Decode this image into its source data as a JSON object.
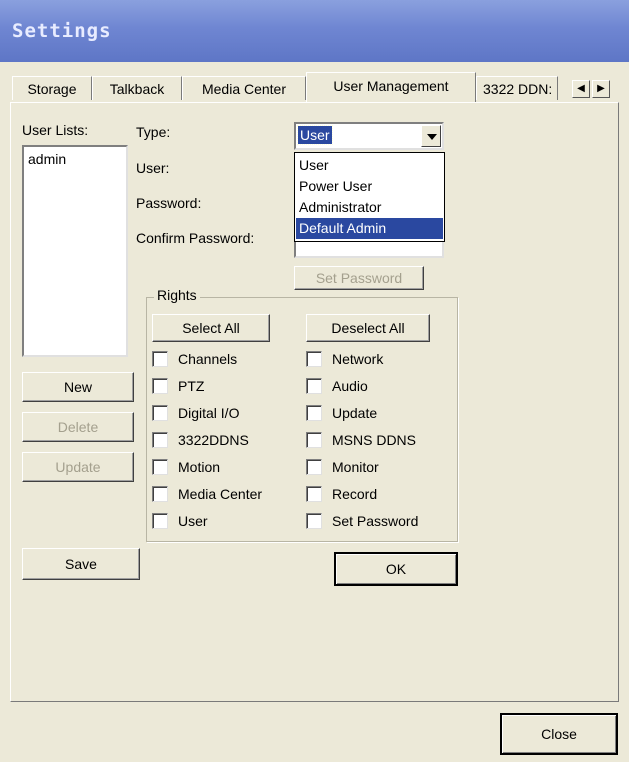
{
  "window": {
    "title": "Settings"
  },
  "tabs": [
    {
      "label": "Storage"
    },
    {
      "label": "Talkback"
    },
    {
      "label": "Media Center"
    },
    {
      "label": "User Management"
    },
    {
      "label": "3322 DDN:"
    }
  ],
  "active_tab": "User Management",
  "user_lists": {
    "label": "User Lists:",
    "items": [
      "admin"
    ]
  },
  "form": {
    "type_label": "Type:",
    "type_value": "User",
    "user_label": "User:",
    "password_label": "Password:",
    "confirm_label": "Confirm Password:",
    "set_password_button": "Set Password"
  },
  "type_options": [
    "User",
    "Power User",
    "Administrator",
    "Default Admin"
  ],
  "type_highlighted": "Default Admin",
  "buttons": {
    "new": "New",
    "delete": "Delete",
    "update": "Update",
    "save": "Save",
    "ok": "OK",
    "close": "Close",
    "select_all": "Select All",
    "deselect_all": "Deselect All"
  },
  "rights": {
    "legend": "Rights",
    "left": [
      "Channels",
      "PTZ",
      "Digital I/O",
      "3322DDNS",
      "Motion",
      "Media Center",
      "User"
    ],
    "right": [
      "Network",
      "Audio",
      "Update",
      "MSNS DDNS",
      "Monitor",
      "Record",
      "Set Password"
    ]
  },
  "icons": {
    "scroll_left": "left-arrow-icon",
    "scroll_right": "right-arrow-icon",
    "dropdown": "chevron-down-icon"
  },
  "colors": {
    "titlebar": "#6f86d2",
    "selection": "#2a48a0",
    "face": "#ece9d8"
  }
}
